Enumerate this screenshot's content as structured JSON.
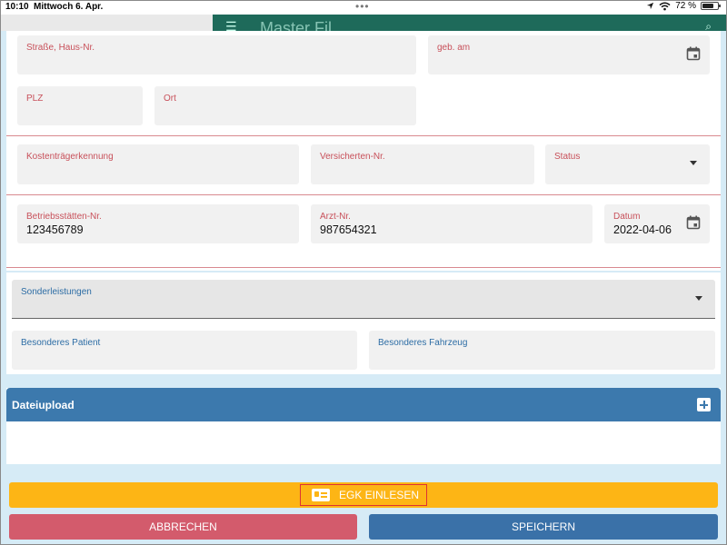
{
  "status_bar": {
    "time": "10:10",
    "date": "Mittwoch 6. Apr.",
    "dots": "•••",
    "battery": "72 %",
    "battery_level": 0.72
  },
  "background_app": {
    "title": "Master Fil..."
  },
  "form": {
    "street": {
      "label": "Straße, Haus-Nr.",
      "value": ""
    },
    "birthdate": {
      "label": "geb. am",
      "value": "",
      "icon": "calendar-icon"
    },
    "zip": {
      "label": "PLZ",
      "value": ""
    },
    "city": {
      "label": "Ort",
      "value": ""
    },
    "cost_carrier": {
      "label": "Kostenträgerkennung",
      "value": ""
    },
    "insured_number": {
      "label": "Versicherten-Nr.",
      "value": ""
    },
    "status": {
      "label": "Status",
      "value": ""
    },
    "site_number": {
      "label": "Betriebsstätten-Nr.",
      "value": "123456789"
    },
    "doctor_number": {
      "label": "Arzt-Nr.",
      "value": "987654321"
    },
    "date": {
      "label": "Datum",
      "value": "2022-04-06",
      "icon": "calendar-icon"
    }
  },
  "extras": {
    "special_services": {
      "label": "Sonderleistungen",
      "value": ""
    },
    "special_patient": {
      "label": "Besonderes Patient",
      "value": ""
    },
    "special_vehicle": {
      "label": "Besonderes Fahrzeug",
      "value": ""
    }
  },
  "upload": {
    "title": "Dateiupload"
  },
  "buttons": {
    "egk": "EGK EINLESEN",
    "cancel": "ABBRECHEN",
    "save": "SPEICHERN"
  },
  "colors": {
    "accent_red": "#c8505a",
    "accent_blue": "#2d6da5",
    "egk_button": "#fdb515",
    "cancel_button": "#d35b6c",
    "save_button": "#3a71a8",
    "upload_header": "#3c79ad"
  }
}
